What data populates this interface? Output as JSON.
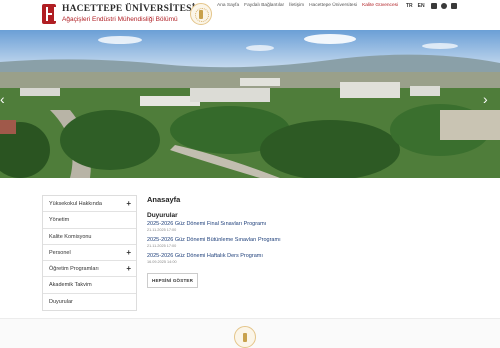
{
  "header": {
    "university": "HACETTEPE ÜNİVERSİTESİ",
    "department": "Ağaçişleri Endüstri Mühendisliği Bölümü"
  },
  "topnav": {
    "items": [
      "Ana Sayfa",
      "Faydalı Bağlantılar",
      "İletişim",
      "Hacettepe Üniversitesi",
      "Kalite Güvencesi"
    ],
    "accent": "#b01e23"
  },
  "lang": [
    "TR",
    "EN"
  ],
  "social_icons": [
    "instagram-icon",
    "youtube-icon",
    "x-twitter-icon"
  ],
  "sidebar": {
    "items": [
      {
        "label": "Yüksekokul Hakkında",
        "expandable": true
      },
      {
        "label": "Yönetim",
        "expandable": false
      },
      {
        "label": "Kalite Komisyonu",
        "expandable": false
      },
      {
        "label": "Personel",
        "expandable": true
      },
      {
        "label": "Öğretim Programları",
        "expandable": true
      },
      {
        "label": "Akademik Takvim",
        "expandable": false
      },
      {
        "label": "Duyurular",
        "expandable": false
      }
    ],
    "plus_symbol": "+"
  },
  "main": {
    "title": "Anasayfa",
    "section": "Duyurular",
    "announcements": [
      {
        "title": "2025-2026 Güz Dönemi Final Sınavları Programı",
        "date": "21.11.2025 17:00"
      },
      {
        "title": "2025-2026 Güz Dönemi Bütünleme Sınavları Programı",
        "date": "21.11.2025 17:00"
      },
      {
        "title": "2025-2026 Güz Dönemi Haftalık Ders Programı",
        "date": "16.09.2025 14:00"
      }
    ],
    "show_all": "HEPSİNİ GÖSTER"
  },
  "hero": {
    "prev_symbol": "‹",
    "next_symbol": "›"
  }
}
